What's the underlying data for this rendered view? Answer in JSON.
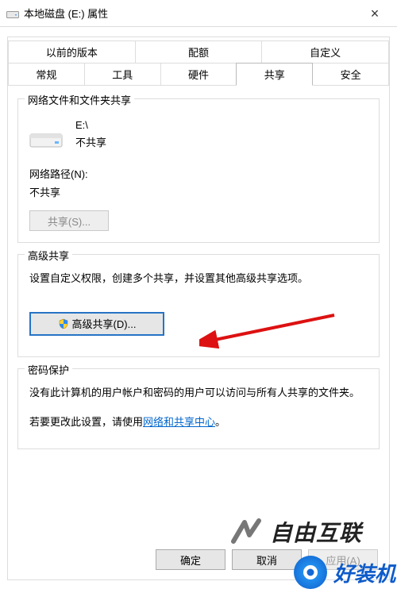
{
  "title": "本地磁盘 (E:) 属性",
  "tabs_top": [
    "以前的版本",
    "配额",
    "自定义"
  ],
  "tabs_bottom": [
    "常规",
    "工具",
    "硬件",
    "共享",
    "安全"
  ],
  "active_tab": "共享",
  "group_share": {
    "title": "网络文件和文件夹共享",
    "drive_letter": "E:\\",
    "share_state": "不共享",
    "net_path_label": "网络路径(N):",
    "net_path_value": "不共享",
    "share_btn": "共享(S)..."
  },
  "group_adv": {
    "title": "高级共享",
    "desc": "设置自定义权限，创建多个共享，并设置其他高级共享选项。",
    "btn": "高级共享(D)..."
  },
  "group_pw": {
    "title": "密码保护",
    "desc1": "没有此计算机的用户帐户和密码的用户可以访问与所有人共享的文件夹。",
    "desc2_prefix": "若要更改此设置，请使用",
    "link": "网络和共享中心",
    "desc2_suffix": "。"
  },
  "buttons": {
    "ok": "确定",
    "cancel": "取消",
    "apply": "应用(A)"
  },
  "watermark1": "自由互联",
  "watermark2": "好装机"
}
